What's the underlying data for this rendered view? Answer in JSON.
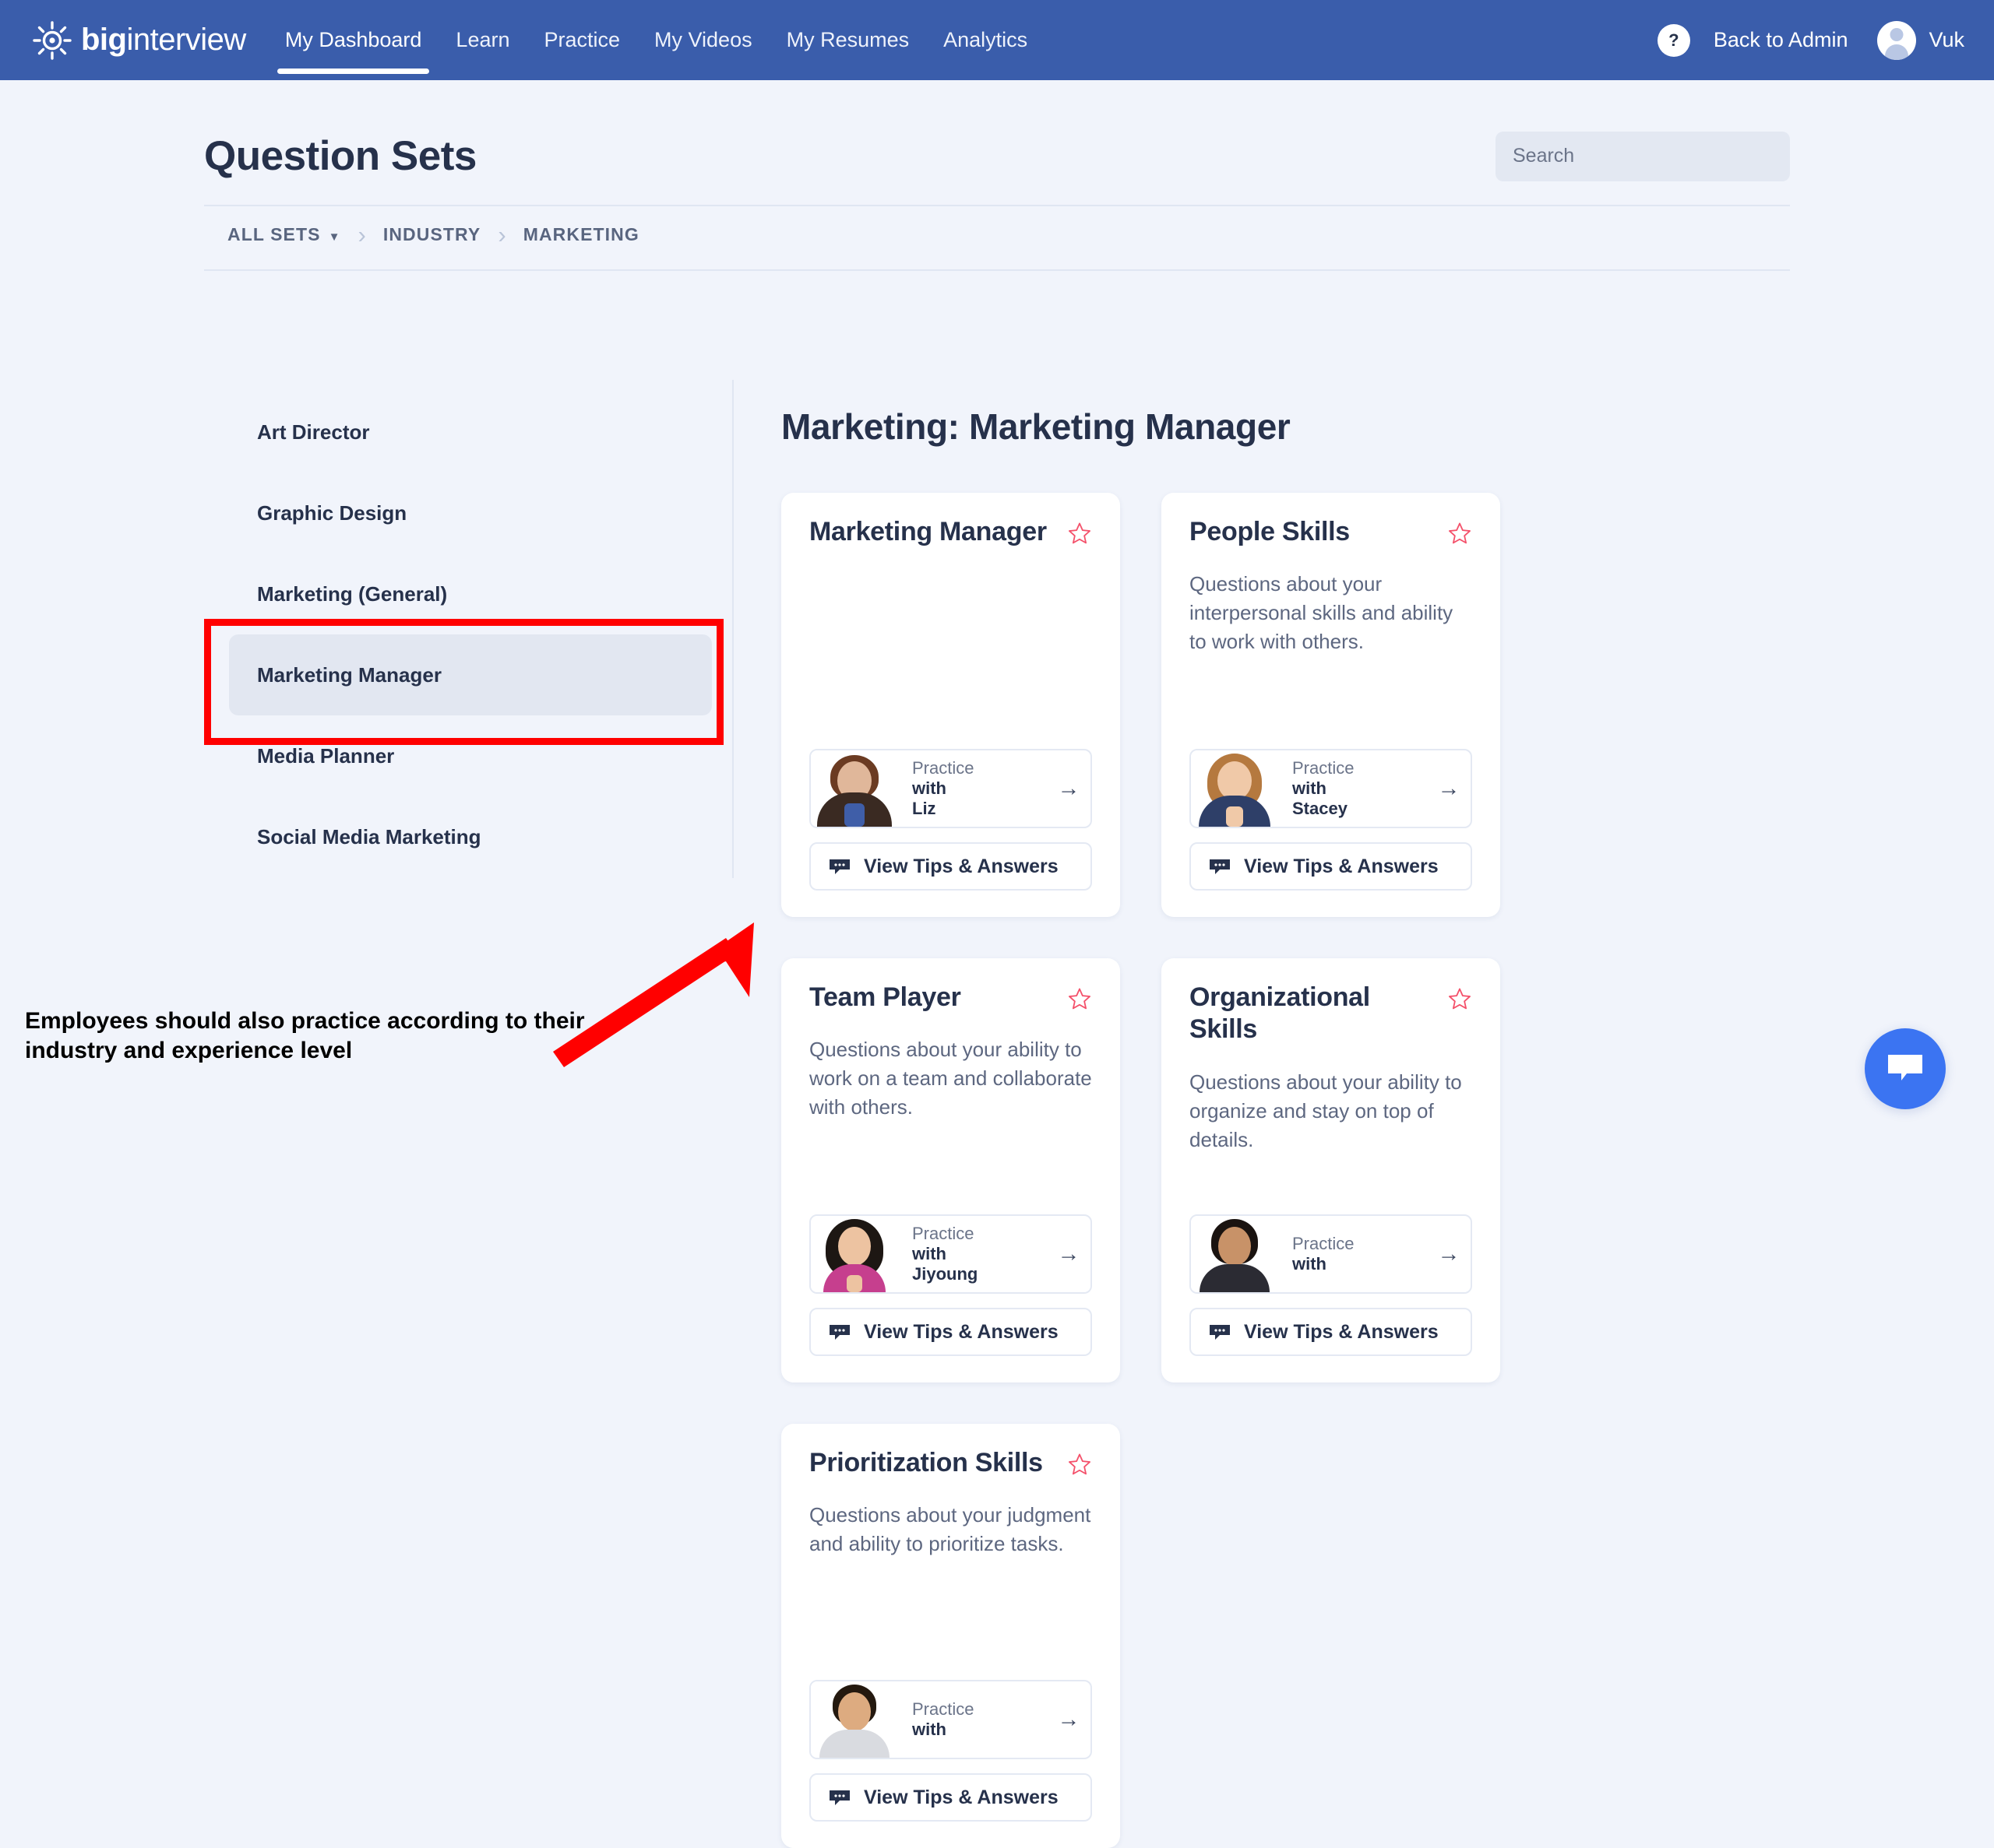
{
  "header": {
    "logo": {
      "bold": "big",
      "light": "interview",
      "icon": "sun-icon"
    },
    "nav": [
      {
        "label": "My Dashboard",
        "active": true
      },
      {
        "label": "Learn",
        "active": false
      },
      {
        "label": "Practice",
        "active": false
      },
      {
        "label": "My Videos",
        "active": false
      },
      {
        "label": "My Resumes",
        "active": false
      },
      {
        "label": "Analytics",
        "active": false
      }
    ],
    "help_label": "?",
    "admin_label": "Back to Admin",
    "user_name": "Vuk",
    "bg_color": "#3a5dab"
  },
  "page": {
    "title": "Question Sets",
    "search_placeholder": "Search",
    "search_value": ""
  },
  "breadcrumb": {
    "items": [
      {
        "label": "ALL SETS",
        "has_caret": true
      },
      {
        "label": "INDUSTRY",
        "has_caret": false
      },
      {
        "label": "MARKETING",
        "has_caret": false
      }
    ],
    "separator": "›"
  },
  "sidebar": {
    "items": [
      {
        "label": "Art Director",
        "selected": false
      },
      {
        "label": "Graphic Design",
        "selected": false
      },
      {
        "label": "Marketing (General)",
        "selected": false
      },
      {
        "label": "Marketing Manager",
        "selected": true
      },
      {
        "label": "Media Planner",
        "selected": false
      },
      {
        "label": "Social Media Marketing",
        "selected": false
      }
    ]
  },
  "main": {
    "heading": "Marketing: Marketing Manager",
    "cards": [
      {
        "title": "Marketing Manager",
        "description": "",
        "star": "star-outline-icon",
        "practice_label": "Practice",
        "practice_with": "with",
        "practice_name": "Liz",
        "arrow": "→",
        "tips_label": "View Tips & Answers",
        "avatar": {
          "skin": "#e0b79a",
          "hair": "#6b3b22",
          "clothes": "#3a2a22",
          "inner": "#3f5ea8"
        }
      },
      {
        "title": "People Skills",
        "description": "Questions about your interpersonal skills and ability to work with others.",
        "star": "star-outline-icon",
        "practice_label": "Practice",
        "practice_with": "with",
        "practice_name": "Stacey",
        "arrow": "→",
        "tips_label": "View Tips & Answers",
        "avatar": {
          "skin": "#f0c9a8",
          "hair": "#b5793f",
          "clothes": "#2e3f68",
          "inner": "#f0c9a8"
        }
      },
      {
        "title": "Team Player",
        "description": "Questions about your ability to work on a team and collaborate with others.",
        "star": "star-outline-icon",
        "practice_label": "Practice",
        "practice_with": "with",
        "practice_name": "Jiyoung",
        "arrow": "→",
        "tips_label": "View Tips & Answers",
        "avatar": {
          "skin": "#edc3a1",
          "hair": "#1d1713",
          "clothes": "#c63f8e",
          "inner": "#edc3a1"
        }
      },
      {
        "title": "Organizational Skills",
        "description": "Questions about your ability to organize and stay on top of details.",
        "star": "star-outline-icon",
        "practice_label": "Practice",
        "practice_with": "with",
        "practice_name": "",
        "arrow": "→",
        "tips_label": "View Tips & Answers",
        "avatar": {
          "skin": "#c89268",
          "hair": "#1a1310",
          "clothes": "#2b2b33",
          "inner": "#c89268"
        }
      },
      {
        "title": "Prioritization Skills",
        "description": "Questions about your judgment and ability to prioritize tasks.",
        "star": "star-outline-icon",
        "practice_label": "Practice",
        "practice_with": "with",
        "practice_name": "",
        "arrow": "→",
        "tips_label": "View Tips & Answers",
        "avatar": {
          "skin": "#ddab80",
          "hair": "#24190f",
          "clothes": "#d9dbe0",
          "inner": "#ddab80"
        }
      }
    ]
  },
  "annotation": {
    "text": "Employees should also practice according to their industry and experience level",
    "arrow_color": "#ff0000",
    "highlight_color": "#ff0000"
  },
  "chat_widget": {
    "icon": "chat-bubble-icon",
    "color": "#3b74f2"
  }
}
